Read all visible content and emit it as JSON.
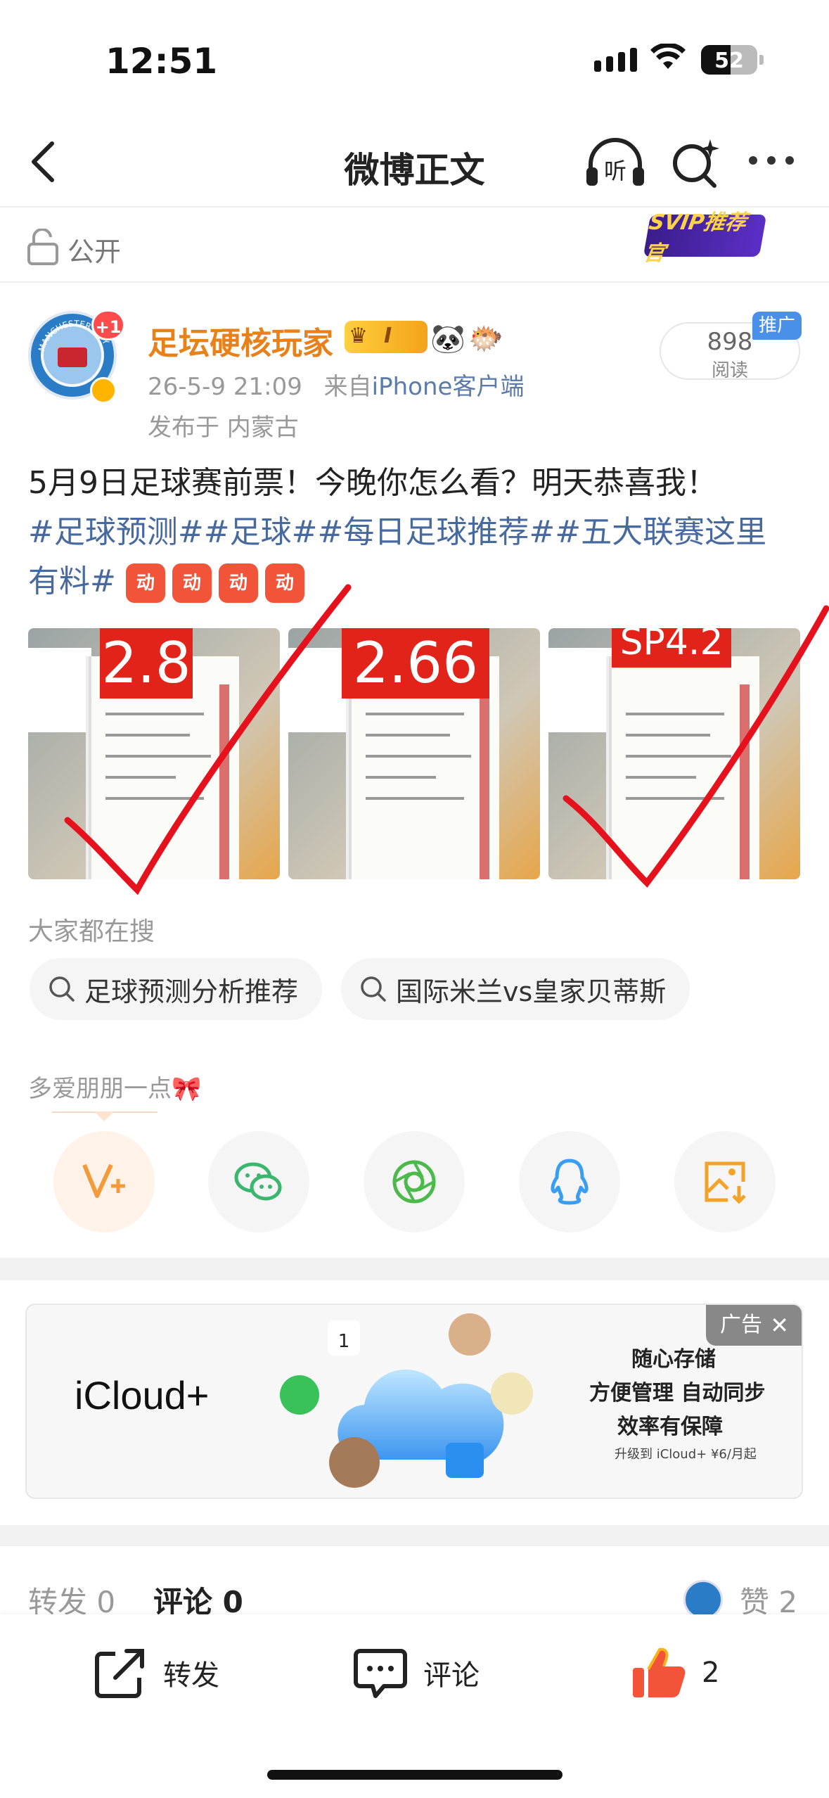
{
  "status": {
    "time": "12:51",
    "battery": "52",
    "battery_level": 0.52
  },
  "nav": {
    "title": "微博正文",
    "listen_label": "听"
  },
  "visibility": {
    "label": "公开",
    "svip_badge": "SVIP推荐官"
  },
  "post": {
    "notification_badge": "+1",
    "avatar_text": "MANCHESTER CITY",
    "username": "足坛硬核玩家",
    "level_badge": "I",
    "meta_date": "26-5-9 21:09",
    "meta_from": "来自",
    "meta_source": "iPhone客户端",
    "location": "发布于 内蒙古",
    "read_count": "898",
    "read_label": "阅读",
    "promo_label": "推广",
    "text": "5月9日足球赛前票！今晚你怎么看？明天恭喜我！",
    "hashtags": "#足球预测##足球##每日足球推荐##五大联赛这里",
    "hashtags_tail": "有料#",
    "emoji_label": "动",
    "images": [
      {
        "odds": "2.8"
      },
      {
        "odds": "2.66"
      },
      {
        "odds": "SP4.2"
      }
    ]
  },
  "hot_search": {
    "title": "大家都在搜",
    "chips": [
      "足球预测分析推荐",
      "国际米兰vs皇家贝蒂斯"
    ]
  },
  "share": {
    "title": "多爱朋朋一点",
    "items": [
      "v-plus-icon",
      "wechat-icon",
      "moments-icon",
      "qq-icon",
      "save-image-icon"
    ]
  },
  "ad": {
    "brand": "iCloud+",
    "tag": "广告",
    "close": "✕",
    "line1": "随心存储",
    "line2": "方便管理 自动同步",
    "line3": "效率有保障",
    "line4": "升级到 iCloud+ ¥6/月起",
    "calendar_day": "1"
  },
  "stats": {
    "repost_label": "转发",
    "repost_count": "0",
    "comment_label": "评论",
    "comment_count": "0",
    "like_label": "赞",
    "like_count": "2"
  },
  "bottom_bar": {
    "repost": "转发",
    "comment": "评论",
    "like_count": "2"
  },
  "colors": {
    "username": "#e8811a",
    "hashtag": "#47699e",
    "checkmark": "#e5121e",
    "like": "#f2543a"
  }
}
